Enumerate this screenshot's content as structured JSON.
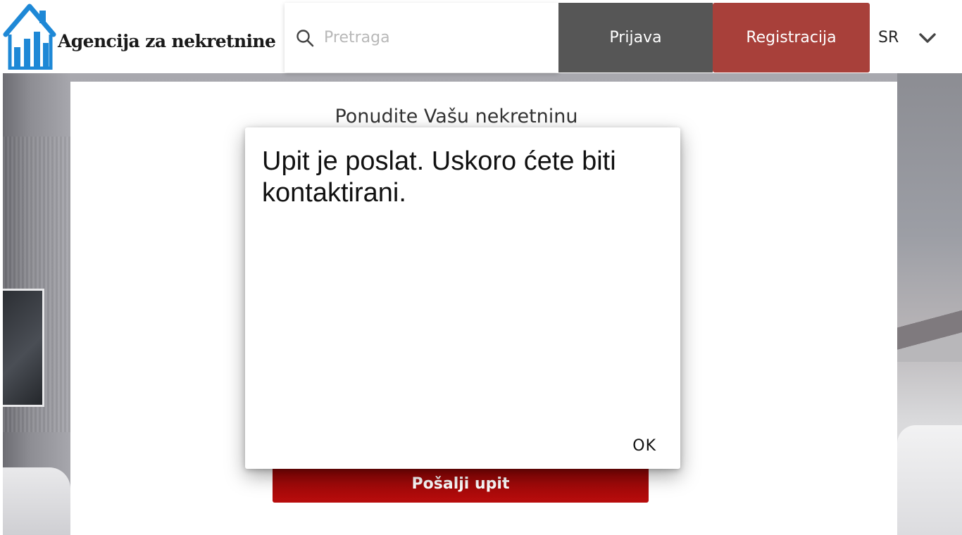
{
  "header": {
    "logo_text": "Agencija za nekretnine",
    "search_placeholder": "Pretraga",
    "login_label": "Prijava",
    "register_label": "Registracija",
    "language": "SR"
  },
  "main": {
    "title": "Ponudite Vašu nekretninu",
    "submit_label": "Pošalji upit"
  },
  "dialog": {
    "message": "Upit je poslat. Uskoro ćete biti kontaktirani.",
    "ok_label": "OK"
  },
  "colors": {
    "login_bg": "#565656",
    "register_bg": "#a8403a",
    "submit_bg": "#b80c0c",
    "logo_blue": "#1e88d6"
  },
  "icons": {
    "logo": "house-chart-icon",
    "search": "search-icon",
    "language": "chevron-down-icon"
  }
}
